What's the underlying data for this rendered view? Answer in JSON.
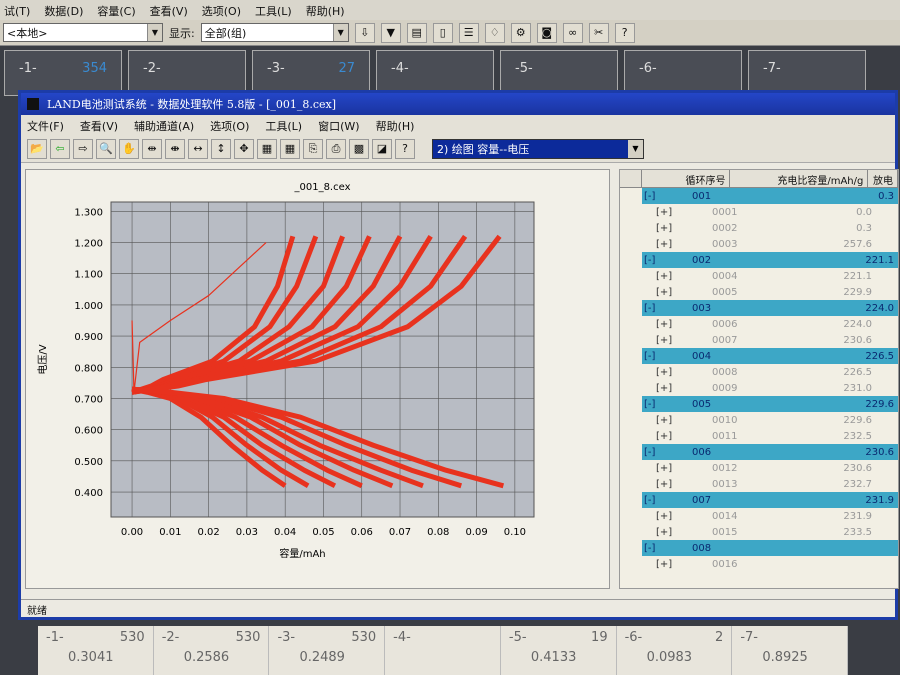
{
  "bg": {
    "menu": [
      "试(T)",
      "数据(D)",
      "容量(C)",
      "查看(V)",
      "选项(O)",
      "工具(L)",
      "帮助(H)"
    ],
    "location": "<本地>",
    "display_label": "显示:",
    "display_value": "全部(组)",
    "channels": [
      {
        "name": "-1-",
        "count": "354"
      },
      {
        "name": "-2-",
        "count": ""
      },
      {
        "name": "-3-",
        "count": "27"
      },
      {
        "name": "-4-",
        "count": ""
      },
      {
        "name": "-5-",
        "count": ""
      },
      {
        "name": "-6-",
        "count": ""
      },
      {
        "name": "-7-",
        "count": ""
      }
    ]
  },
  "window": {
    "title": "LAND电池测试系统 - 数据处理软件 5.8版 - [_001_8.cex]",
    "menu": [
      "文件(F)",
      "查看(V)",
      "辅助通道(A)",
      "选项(O)",
      "工具(L)",
      "窗口(W)",
      "帮助(H)"
    ],
    "plot_select": "2) 绘图  容量--电压",
    "status": "就绪"
  },
  "table": {
    "headers": [
      "循环序号",
      "充电比容量/mAh/g",
      "放电"
    ],
    "groups": [
      {
        "id": "001",
        "value": "0.3",
        "rows": [
          [
            "0001",
            "0.0"
          ],
          [
            "0002",
            "0.3"
          ],
          [
            "0003",
            "257.6"
          ]
        ]
      },
      {
        "id": "002",
        "value": "221.1",
        "rows": [
          [
            "0004",
            "221.1"
          ],
          [
            "0005",
            "229.9"
          ]
        ]
      },
      {
        "id": "003",
        "value": "224.0",
        "rows": [
          [
            "0006",
            "224.0"
          ],
          [
            "0007",
            "230.6"
          ]
        ]
      },
      {
        "id": "004",
        "value": "226.5",
        "rows": [
          [
            "0008",
            "226.5"
          ],
          [
            "0009",
            "231.0"
          ]
        ]
      },
      {
        "id": "005",
        "value": "229.6",
        "rows": [
          [
            "0010",
            "229.6"
          ],
          [
            "0011",
            "232.5"
          ]
        ]
      },
      {
        "id": "006",
        "value": "230.6",
        "rows": [
          [
            "0012",
            "230.6"
          ],
          [
            "0013",
            "232.7"
          ]
        ]
      },
      {
        "id": "007",
        "value": "231.9",
        "rows": [
          [
            "0014",
            "231.9"
          ],
          [
            "0015",
            "233.5"
          ]
        ]
      },
      {
        "id": "008",
        "value": "",
        "rows": [
          [
            "0016",
            ""
          ]
        ]
      }
    ]
  },
  "bottom": [
    {
      "name": "-1-",
      "count": "530",
      "value": "0.3041"
    },
    {
      "name": "-2-",
      "count": "530",
      "value": "0.2586"
    },
    {
      "name": "-3-",
      "count": "530",
      "value": "0.2489"
    },
    {
      "name": "-4-",
      "count": "",
      "value": ""
    },
    {
      "name": "-5-",
      "count": "19",
      "value": "0.4133"
    },
    {
      "name": "-6-",
      "count": "2",
      "value": "0.0983"
    },
    {
      "name": "-7-",
      "count": "",
      "value": "0.8925"
    }
  ],
  "chart_data": {
    "type": "line",
    "title": "_001_8.cex",
    "xlabel": "容量/mAh",
    "ylabel": "电压/V",
    "xlim": [
      -0.0055,
      0.105
    ],
    "ylim": [
      0.32,
      1.33
    ],
    "grid": true,
    "color": "#e8321e",
    "xticks": [
      "0.00",
      "0.01",
      "0.02",
      "0.03",
      "0.04",
      "0.05",
      "0.06",
      "0.07",
      "0.08",
      "0.09",
      "0.10"
    ],
    "yticks": [
      "0.400",
      "0.500",
      "0.600",
      "0.700",
      "0.800",
      "0.900",
      "1.000",
      "1.100",
      "1.200",
      "1.300"
    ],
    "charge_y": [
      0.72,
      0.74,
      0.76,
      0.82,
      0.93,
      1.06,
      1.22
    ],
    "charge_x": [
      [
        0,
        0.005,
        0.008,
        0.021,
        0.032,
        0.038,
        0.042
      ],
      [
        0,
        0.006,
        0.01,
        0.024,
        0.036,
        0.043,
        0.048
      ],
      [
        0,
        0.007,
        0.011,
        0.028,
        0.041,
        0.05,
        0.055
      ],
      [
        0,
        0.007,
        0.012,
        0.031,
        0.047,
        0.056,
        0.062
      ],
      [
        0,
        0.008,
        0.014,
        0.035,
        0.053,
        0.063,
        0.07
      ],
      [
        0,
        0.009,
        0.016,
        0.039,
        0.059,
        0.07,
        0.078
      ],
      [
        0,
        0.01,
        0.017,
        0.044,
        0.065,
        0.078,
        0.087
      ],
      [
        0,
        0.012,
        0.019,
        0.048,
        0.072,
        0.086,
        0.096
      ]
    ],
    "discharge_y": [
      0.73,
      0.72,
      0.7,
      0.64,
      0.55,
      0.47,
      0.42
    ],
    "discharge_x": [
      [
        0,
        0.004,
        0.01,
        0.018,
        0.026,
        0.034,
        0.04
      ],
      [
        0,
        0.005,
        0.012,
        0.021,
        0.03,
        0.039,
        0.046
      ],
      [
        0,
        0.005,
        0.013,
        0.024,
        0.034,
        0.045,
        0.053
      ],
      [
        0,
        0.006,
        0.015,
        0.027,
        0.039,
        0.051,
        0.06
      ],
      [
        0,
        0.007,
        0.017,
        0.031,
        0.044,
        0.058,
        0.068
      ],
      [
        0,
        0.008,
        0.019,
        0.034,
        0.049,
        0.065,
        0.076
      ],
      [
        0,
        0.009,
        0.022,
        0.039,
        0.056,
        0.073,
        0.086
      ],
      [
        0,
        0.01,
        0.024,
        0.044,
        0.063,
        0.082,
        0.097
      ]
    ],
    "first_cycle": {
      "x": [
        0,
        0.0005,
        0.002,
        0.01,
        0.02,
        0.035
      ],
      "y": [
        0.95,
        0.72,
        0.88,
        0.95,
        1.03,
        1.2
      ]
    }
  }
}
